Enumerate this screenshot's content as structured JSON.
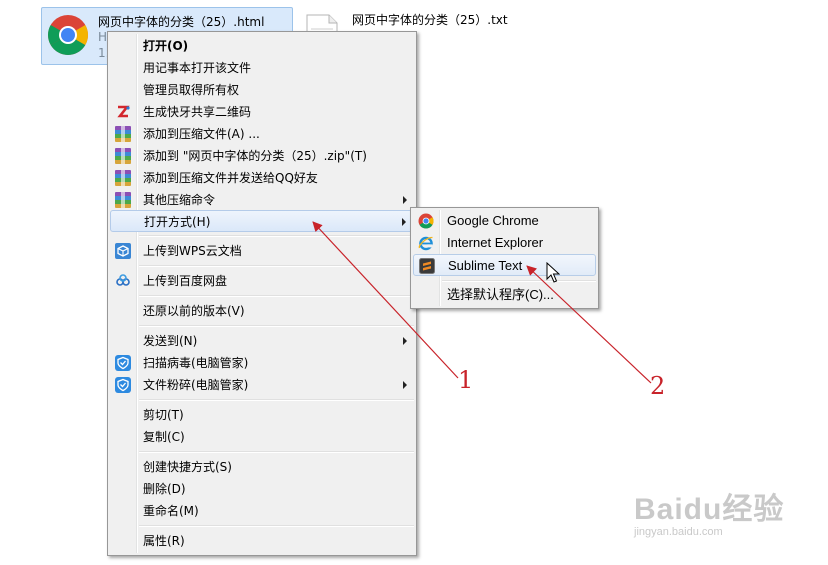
{
  "files": {
    "html_file": {
      "name": "网页中字体的分类（25）.html",
      "type_line": "H",
      "size_line": "1."
    },
    "txt_file": {
      "name": "网页中字体的分类（25）.txt"
    }
  },
  "context_menu": {
    "items": [
      {
        "label": "打开(O)"
      },
      {
        "label": "用记事本打开该文件"
      },
      {
        "label": "管理员取得所有权"
      },
      {
        "label": "生成快牙共享二维码"
      },
      {
        "label": "添加到压缩文件(A) ..."
      },
      {
        "label": "添加到 \"网页中字体的分类（25）.zip\"(T)"
      },
      {
        "label": "添加到压缩文件并发送给QQ好友"
      },
      {
        "label": "其他压缩命令"
      },
      {
        "label": "打开方式(H)"
      },
      {
        "label": "上传到WPS云文档"
      },
      {
        "label": "上传到百度网盘"
      },
      {
        "label": "还原以前的版本(V)"
      },
      {
        "label": "发送到(N)"
      },
      {
        "label": "扫描病毒(电脑管家)"
      },
      {
        "label": "文件粉碎(电脑管家)"
      },
      {
        "label": "剪切(T)"
      },
      {
        "label": "复制(C)"
      },
      {
        "label": "创建快捷方式(S)"
      },
      {
        "label": "删除(D)"
      },
      {
        "label": "重命名(M)"
      },
      {
        "label": "属性(R)"
      }
    ]
  },
  "open_with_menu": {
    "items": [
      {
        "label": "Google Chrome"
      },
      {
        "label": "Internet Explorer"
      },
      {
        "label": "Sublime Text"
      },
      {
        "label": "选择默认程序(C)..."
      }
    ]
  },
  "annotations": {
    "one": "1",
    "two": "2"
  },
  "watermark": {
    "text": "Baidu经验",
    "url": "jingyan.baidu.com"
  },
  "colors": {
    "annotation": "#c8232a",
    "selection": "#d9e9fb",
    "menu_bg": "#f0f0f0"
  }
}
